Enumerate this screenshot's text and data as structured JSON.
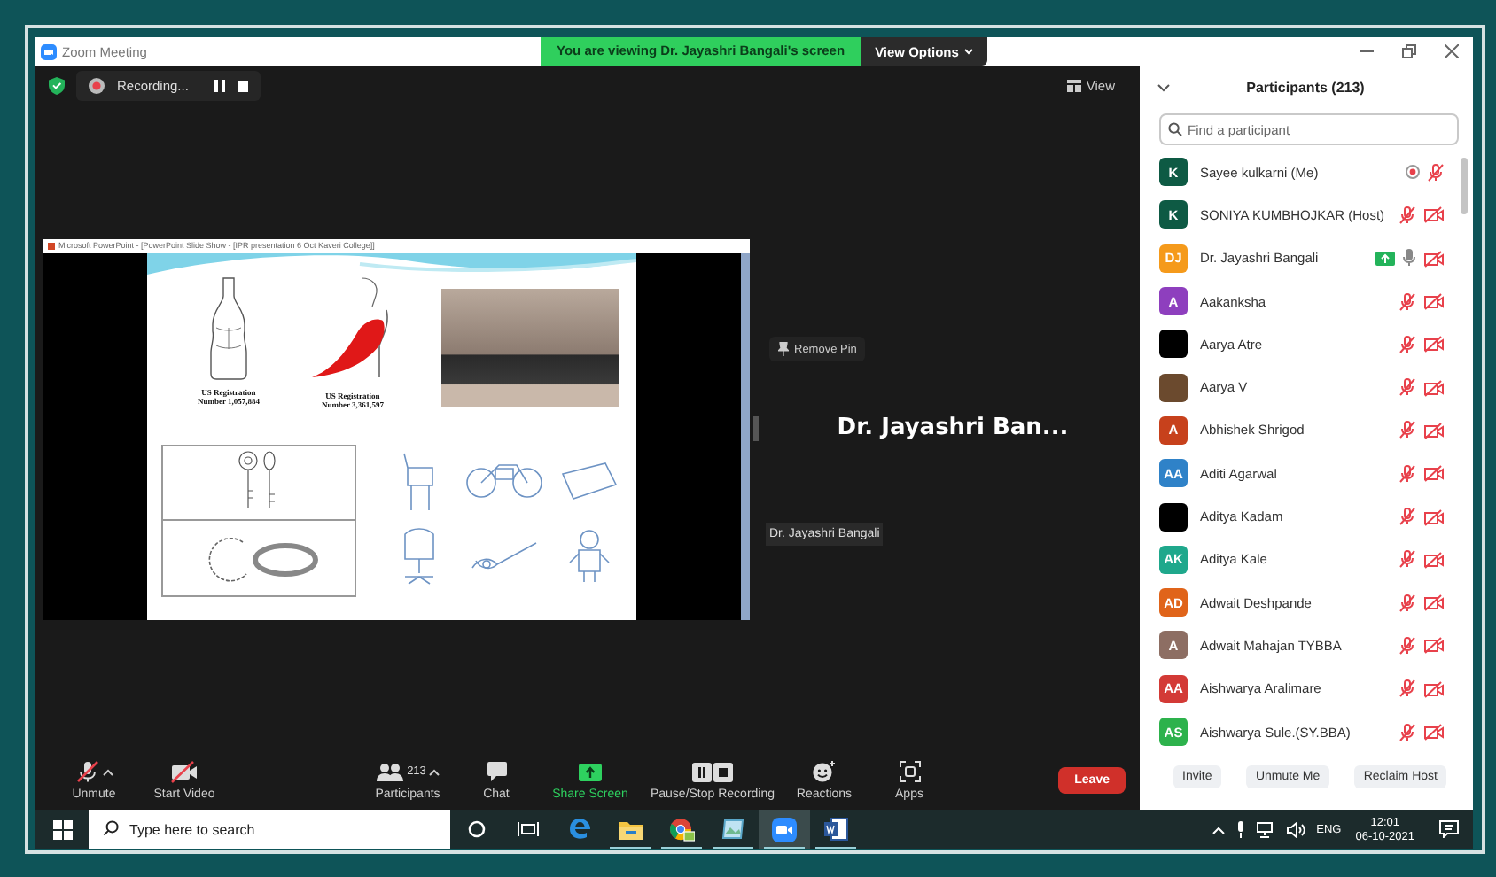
{
  "window": {
    "title": "Zoom Meeting",
    "banner": "You are viewing Dr. Jayashri Bangali's screen",
    "view_options": "View Options"
  },
  "top_bar": {
    "recording_label": "Recording...",
    "view_label": "View"
  },
  "shared_screen": {
    "window_title": "Microsoft PowerPoint - [PowerPoint Slide Show - [IPR presentation 6 Oct Kaveri College]]",
    "captions": [
      "US Registration\nNumber 1,057,884",
      "US Registration\nNumber 3,361,597"
    ]
  },
  "speaker": {
    "pin_label": "Remove Pin",
    "name": "Dr. Jayashri Ban...",
    "name_tag": "Dr. Jayashri Bangali"
  },
  "toolbar": {
    "items": [
      {
        "kind": "unmute",
        "label": "Unmute",
        "caret": true
      },
      {
        "kind": "video",
        "label": "Start Video",
        "caret": false
      },
      {
        "kind": "participants",
        "label": "Participants",
        "count": "213",
        "caret": true
      },
      {
        "kind": "chat",
        "label": "Chat",
        "caret": false
      },
      {
        "kind": "share",
        "label": "Share Screen",
        "caret": false
      },
      {
        "kind": "recording",
        "label": "Pause/Stop Recording",
        "caret": false
      },
      {
        "kind": "reactions",
        "label": "Reactions",
        "caret": false
      },
      {
        "kind": "apps",
        "label": "Apps",
        "caret": false
      }
    ],
    "leave": "Leave"
  },
  "participants_panel": {
    "title": "Participants (213)",
    "search_placeholder": "Find a participant",
    "participants": [
      {
        "name": "Sayee kulkarni (Me)",
        "avatar": {
          "kind": "initials",
          "text": "K",
          "color": "#0e5a44"
        },
        "mic_muted": true,
        "video_off": false,
        "recording": true,
        "sharing": false
      },
      {
        "name": "SONIYA KUMBHOJKAR (Host)",
        "avatar": {
          "kind": "initials",
          "text": "K",
          "color": "#0e5a44"
        },
        "mic_muted": true,
        "video_off": true,
        "recording": false,
        "sharing": false
      },
      {
        "name": "Dr. Jayashri Bangali",
        "avatar": {
          "kind": "initials",
          "text": "DJ",
          "color": "#f59a1b"
        },
        "mic_muted": false,
        "video_off": true,
        "recording": false,
        "sharing": true
      },
      {
        "name": "Aakanksha",
        "avatar": {
          "kind": "initials",
          "text": "A",
          "color": "#8e3fbe"
        },
        "mic_muted": true,
        "video_off": true,
        "recording": false,
        "sharing": false
      },
      {
        "name": "Aarya Atre",
        "avatar": {
          "kind": "photo",
          "color": "#000000"
        },
        "mic_muted": true,
        "video_off": true,
        "recording": false,
        "sharing": false
      },
      {
        "name": "Aarya V",
        "avatar": {
          "kind": "photo",
          "color": "#6b4a2e"
        },
        "mic_muted": true,
        "video_off": true,
        "recording": false,
        "sharing": false
      },
      {
        "name": "Abhishek Shrigod",
        "avatar": {
          "kind": "initials",
          "text": "A",
          "color": "#c7411c"
        },
        "mic_muted": true,
        "video_off": true,
        "recording": false,
        "sharing": false
      },
      {
        "name": "Aditi Agarwal",
        "avatar": {
          "kind": "initials",
          "text": "AA",
          "color": "#2f82c8"
        },
        "mic_muted": true,
        "video_off": true,
        "recording": false,
        "sharing": false
      },
      {
        "name": "Aditya Kadam",
        "avatar": {
          "kind": "photo",
          "color": "#000000"
        },
        "mic_muted": true,
        "video_off": true,
        "recording": false,
        "sharing": false
      },
      {
        "name": "Aditya Kale",
        "avatar": {
          "kind": "initials",
          "text": "AK",
          "color": "#1fa88c"
        },
        "mic_muted": true,
        "video_off": true,
        "recording": false,
        "sharing": false
      },
      {
        "name": "Adwait Deshpande",
        "avatar": {
          "kind": "initials",
          "text": "AD",
          "color": "#e0641a"
        },
        "mic_muted": true,
        "video_off": true,
        "recording": false,
        "sharing": false
      },
      {
        "name": "Adwait Mahajan TYBBA",
        "avatar": {
          "kind": "initials",
          "text": "A",
          "color": "#8d6e63"
        },
        "mic_muted": true,
        "video_off": true,
        "recording": false,
        "sharing": false
      },
      {
        "name": "Aishwarya Aralimare",
        "avatar": {
          "kind": "initials",
          "text": "AA",
          "color": "#d33a36"
        },
        "mic_muted": true,
        "video_off": true,
        "recording": false,
        "sharing": false
      },
      {
        "name": "Aishwarya Sule.(SY.BBA)",
        "avatar": {
          "kind": "initials",
          "text": "AS",
          "color": "#2db24c"
        },
        "mic_muted": true,
        "video_off": true,
        "recording": false,
        "sharing": false
      }
    ],
    "buttons": [
      "Invite",
      "Unmute Me",
      "Reclaim Host"
    ]
  },
  "taskbar": {
    "search_placeholder": "Type here to search",
    "apps": [
      {
        "kind": "edge",
        "running": false,
        "selected": false
      },
      {
        "kind": "explorer",
        "running": true,
        "selected": false
      },
      {
        "kind": "chrome",
        "running": true,
        "selected": false
      },
      {
        "kind": "photos",
        "running": true,
        "selected": false
      },
      {
        "kind": "zoom",
        "running": true,
        "selected": true
      },
      {
        "kind": "word",
        "running": true,
        "selected": false
      }
    ],
    "language": "ENG",
    "time": "12:01",
    "date": "06-10-2021"
  }
}
